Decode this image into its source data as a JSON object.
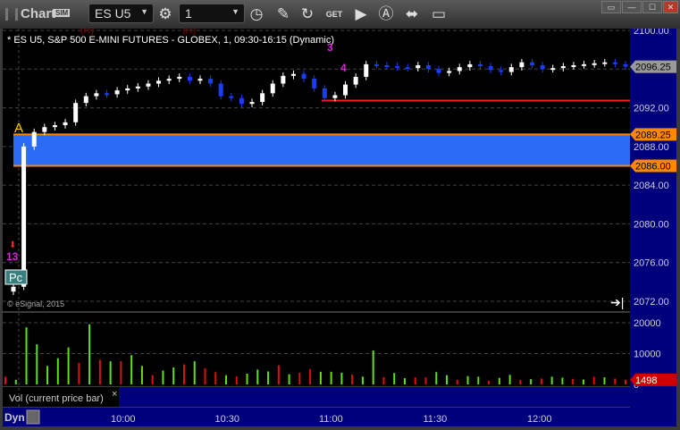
{
  "window": {
    "title": "Chart",
    "sim_badge": "SIM",
    "symbol": "ES U5",
    "interval": "1",
    "toolbar_icons": [
      "settings-gear-icon",
      "clock-icon",
      "pencil-icon",
      "refresh-icon",
      "get-icon",
      "play-icon",
      "alert-icon",
      "link-icon",
      "comment-icon"
    ],
    "controls": [
      "restore-icon",
      "minimize-icon",
      "maximize-icon",
      "close-icon"
    ]
  },
  "chart": {
    "header": "* ES U5, S&P 500 E-MINI FUTURES - GLOBEX, 1, 09:30-16:15 (Dynamic)",
    "copyright": "© eSignal, 2015",
    "price_axis": [
      "2100.00",
      "2092.00",
      "2088.00",
      "2084.00",
      "2080.00",
      "2076.00",
      "2072.00"
    ],
    "price_ticks": [
      2100,
      2096,
      2092,
      2088,
      2084,
      2080,
      2076,
      2072
    ],
    "price_range": [
      2072,
      2100
    ],
    "last_price": "2096.25",
    "zone": {
      "high": 2089.25,
      "low": 2086.0,
      "high_label": "2089.25",
      "low_label": "2086.00",
      "color": "#2a6cf5",
      "edge_color": "#ff8800"
    },
    "red_level": 2092.75,
    "markers": {
      "a": "A",
      "pc": "Pc",
      "n13": "13",
      "n3": "3",
      "n4": "4",
      "r1": "(R)",
      "r2": "(R)"
    },
    "time_labels": [
      "10:00",
      "10:30",
      "11:00",
      "11:30",
      "12:00"
    ],
    "closes": [
      2073.5,
      2088,
      2089.5,
      2090,
      2090.2,
      2090.5,
      2092.5,
      2093.2,
      2093.5,
      2093.4,
      2093.8,
      2094,
      2094.2,
      2094.5,
      2094.8,
      2095,
      2095.2,
      2094.8,
      2095,
      2094.5,
      2093.2,
      2093,
      2092.4,
      2092.6,
      2093.5,
      2094.5,
      2095.3,
      2095.5,
      2095,
      2094,
      2093,
      2093.3,
      2094.4,
      2095.2,
      2096.5,
      2096.4,
      2096.3,
      2096.2,
      2096.1,
      2096.4,
      2096,
      2095.6,
      2095.8,
      2096.2,
      2096.5,
      2096.3,
      2095.9,
      2095.7,
      2096.2,
      2096.7,
      2096.4,
      2096,
      2096.1,
      2096.3,
      2096.4,
      2096.5,
      2096.6,
      2096.7,
      2096.5,
      2096.25
    ],
    "volume_axis": [
      "20000",
      "10000",
      "0"
    ],
    "volume_range": [
      0,
      20000
    ],
    "volumes": [
      2500,
      1500,
      18500,
      13000,
      6000,
      8500,
      12000,
      7000,
      19500,
      8000,
      7500,
      7500,
      9500,
      6000,
      3000,
      4500,
      5500,
      6500,
      7500,
      5200,
      4000,
      3000,
      2600,
      3500,
      4800,
      4200,
      6200,
      3300,
      3800,
      5000,
      4100,
      4100,
      3800,
      3200,
      2500,
      11000,
      2400,
      3700,
      2000,
      2300,
      2300,
      4000,
      3000,
      1500,
      2700,
      2500,
      1200,
      2100,
      3100,
      1500,
      1700,
      1900,
      2500,
      2200,
      1800,
      1600,
      2500,
      2300,
      1900,
      1498
    ],
    "volume_up": [
      false,
      true,
      true,
      true,
      true,
      true,
      true,
      false,
      true,
      false,
      true,
      false,
      true,
      true,
      false,
      true,
      true,
      false,
      true,
      false,
      false,
      true,
      false,
      true,
      true,
      true,
      false,
      true,
      false,
      false,
      true,
      true,
      true,
      false,
      true,
      true,
      false,
      true,
      true,
      false,
      false,
      true,
      true,
      false,
      true,
      true,
      false,
      true,
      true,
      false,
      true,
      false,
      true,
      true,
      false,
      true,
      false,
      true,
      false,
      false
    ],
    "last_volume": "1498",
    "volume_label": "Vol (current price bar)",
    "dyn_label": "Dyn",
    "colors": {
      "up": "#ffffff",
      "down": "#1a3cff",
      "vol_up": "#5ee01a",
      "vol_down": "#e01010",
      "axis_bg": "#00007a",
      "red_line": "#ff1a1a"
    }
  }
}
